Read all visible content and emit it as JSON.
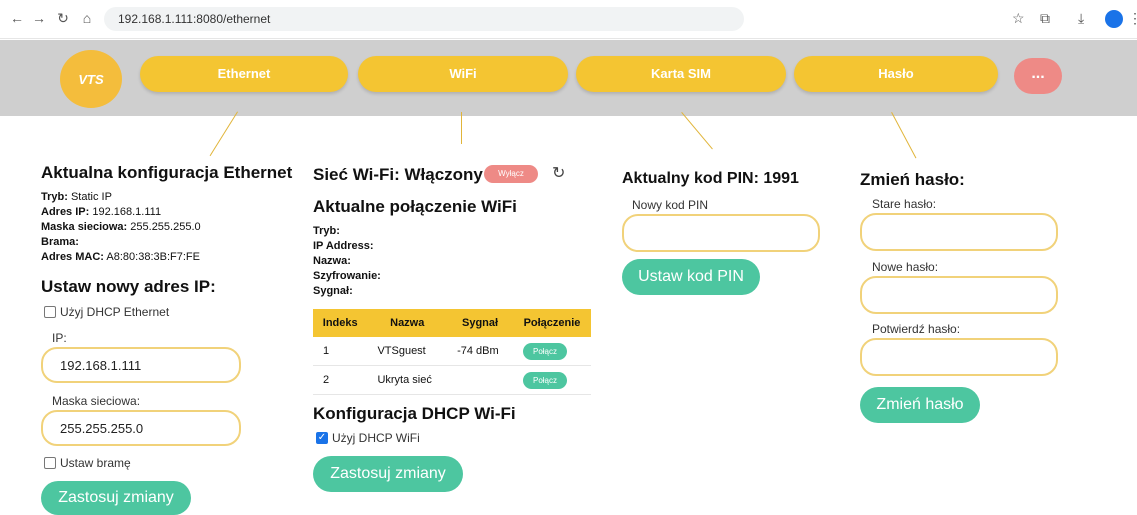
{
  "browser": {
    "url": "192.168.1.111:8080/ethernet"
  },
  "header": {
    "logo_text": "VTS",
    "nav": [
      "Ethernet",
      "WiFi",
      "Karta SIM",
      "Hasło"
    ],
    "more": "..."
  },
  "ethernet": {
    "title": "Aktualna konfiguracja Ethernet",
    "mode_label": "Tryb:",
    "mode": "Static IP",
    "ip_label": "Adres IP:",
    "ip": "192.168.1.111",
    "mask_label": "Maska sieciowa:",
    "mask": "255.255.255.0",
    "gateway_label": "Brama:",
    "mac_label": "Adres MAC:",
    "mac": "A8:80:38:3B:F7:FE",
    "set_title": "Ustaw nowy adres IP:",
    "dhcp_label": "Użyj DHCP Ethernet",
    "ip_field_label": "IP:",
    "ip_field_value": "192.168.1.111",
    "mask_field_label": "Maska sieciowa:",
    "mask_field_value": "255.255.255.0",
    "gateway_checkbox": "Ustaw bramę",
    "apply": "Zastosuj zmiany"
  },
  "wifi": {
    "title": "Sieć Wi-Fi: Włączony",
    "off_button": "Wyłącz",
    "conn_title": "Aktualne połączenie WiFi",
    "mode_label": "Tryb:",
    "ip_label": "IP Address:",
    "name_label": "Nazwa:",
    "enc_label": "Szyfrowanie:",
    "signal_label": "Sygnał:",
    "table_headers": [
      "Indeks",
      "Nazwa",
      "Sygnał",
      "Połączenie"
    ],
    "rows": [
      {
        "index": "1",
        "name": "VTSguest",
        "signal": "-74 dBm",
        "action": "Połącz"
      },
      {
        "index": "2",
        "name": "Ukryta sieć",
        "signal": "",
        "action": "Połącz"
      }
    ],
    "dhcp_title": "Konfiguracja DHCP Wi-Fi",
    "dhcp_label": "Użyj DHCP WiFi",
    "apply": "Zastosuj zmiany"
  },
  "sim": {
    "title": "Aktualny kod PIN: 1991",
    "new_pin_label": "Nowy kod PIN",
    "set_button": "Ustaw kod PIN"
  },
  "password": {
    "title": "Zmień hasło:",
    "old_label": "Stare hasło:",
    "new_label": "Nowe hasło:",
    "confirm_label": "Potwierdź hasło:",
    "change_button": "Zmień hasło"
  },
  "colors": {
    "accent_yellow": "#f4c532",
    "accent_green": "#4dc6a0",
    "accent_red": "#ee8a86"
  }
}
